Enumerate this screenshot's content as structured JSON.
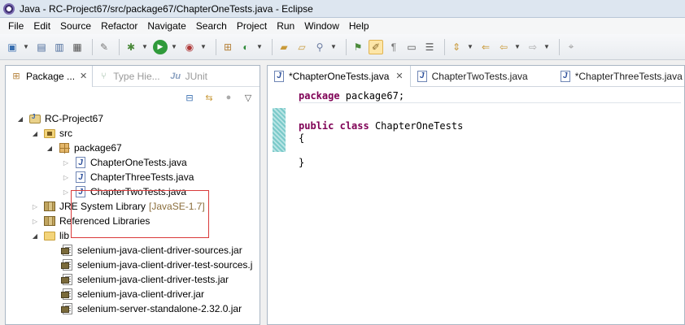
{
  "window": {
    "title": "Java - RC-Project67/src/package67/ChapterOneTests.java - Eclipse"
  },
  "menu": [
    "File",
    "Edit",
    "Source",
    "Refactor",
    "Navigate",
    "Search",
    "Project",
    "Run",
    "Window",
    "Help"
  ],
  "left_tabs": [
    {
      "label": "Package ...",
      "close": "✕"
    },
    {
      "label": "Type Hie..."
    },
    {
      "label": "JUnit"
    }
  ],
  "tree": {
    "project": "RC-Project67",
    "src": "src",
    "package": "package67",
    "files": [
      "ChapterOneTests.java",
      "ChapterThreeTests.java",
      "ChapterTwoTests.java"
    ],
    "jre": {
      "label": "JRE System Library",
      "decor": "[JavaSE-1.7]"
    },
    "referenced": "Referenced Libraries",
    "lib": "lib",
    "jars": [
      "selenium-java-client-driver-sources.jar",
      "selenium-java-client-driver-test-sources.j",
      "selenium-java-client-driver-tests.jar",
      "selenium-java-client-driver.jar",
      "selenium-server-standalone-2.32.0.jar"
    ]
  },
  "editor_tabs": [
    {
      "label": "*ChapterOneTests.java",
      "close": "✕"
    },
    {
      "label": "ChapterTwoTests.java"
    },
    {
      "label": "*ChapterThreeTests.java"
    }
  ],
  "code": {
    "line1_kw": "package",
    "line1_rest": " package67;",
    "line2_kw1": "public",
    "line2_kw2": "class",
    "line2_rest": " ChapterOneTests",
    "line3": "{",
    "line4": "}"
  }
}
